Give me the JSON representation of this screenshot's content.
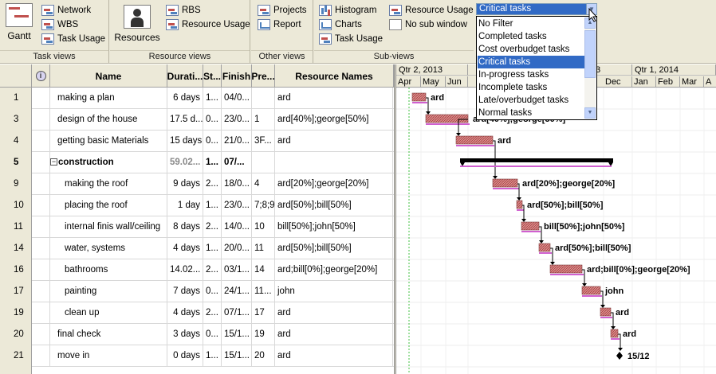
{
  "ribbon": {
    "task_views": {
      "label": "Task views",
      "gantt": "Gantt",
      "network": "Network",
      "wbs": "WBS",
      "task_usage": "Task Usage"
    },
    "resource_views": {
      "label": "Resource views",
      "resources": "Resources",
      "rbs": "RBS",
      "resource_usage": "Resource Usage"
    },
    "other_views": {
      "label": "Other views",
      "projects": "Projects",
      "report": "Report"
    },
    "sub_views": {
      "label": "Sub-views",
      "histogram": "Histogram",
      "charts": "Charts",
      "task_usage": "Task Usage",
      "resource_usage": "Resource Usage",
      "no_sub_window": "No sub window"
    }
  },
  "filter": {
    "selected": "Critical tasks",
    "options": [
      "No Filter",
      "Completed tasks",
      "Cost overbudget tasks",
      "Critical tasks",
      "In-progress tasks",
      "Incomplete tasks",
      "Late/overbudget tasks",
      "Normal tasks"
    ],
    "selected_index": 3
  },
  "table": {
    "columns": {
      "name": "Name",
      "duration": "Durati...",
      "start": "St...",
      "finish": "Finish",
      "pred": "Pre...",
      "resources": "Resource Names"
    },
    "rows": [
      {
        "id": "1",
        "name": "making a plan",
        "duration": "6 days",
        "start": "1...",
        "finish": "04/0...",
        "pred": "",
        "resources": "ard",
        "indent": 0,
        "summary": false
      },
      {
        "id": "3",
        "name": "design of the house",
        "duration": "17.5 d...",
        "start": "0...",
        "finish": "23/0...",
        "pred": "1",
        "resources": "ard[40%];george[50%]",
        "indent": 0,
        "summary": false
      },
      {
        "id": "4",
        "name": "getting basic Materials",
        "duration": "15 days",
        "start": "0...",
        "finish": "21/0...",
        "pred": "3F...",
        "resources": "ard",
        "indent": 0,
        "summary": false
      },
      {
        "id": "5",
        "name": "construction",
        "duration": "59.02...",
        "start": "1...",
        "finish": "07/...",
        "pred": "",
        "resources": "",
        "indent": 0,
        "summary": true
      },
      {
        "id": "9",
        "name": "making the  roof",
        "duration": "9 days",
        "start": "2...",
        "finish": "18/0...",
        "pred": "4",
        "resources": "ard[20%];george[20%]",
        "indent": 1,
        "summary": false
      },
      {
        "id": "10",
        "name": "placing the roof",
        "duration": "1 day",
        "start": "1...",
        "finish": "23/0...",
        "pred": "7;8;9",
        "resources": "ard[50%];bill[50%]",
        "indent": 1,
        "summary": false
      },
      {
        "id": "11",
        "name": "internal finis wall/ceiling",
        "duration": "8 days",
        "start": "2...",
        "finish": "14/0...",
        "pred": "10",
        "resources": "bill[50%];john[50%]",
        "indent": 1,
        "summary": false
      },
      {
        "id": "14",
        "name": "water, systems",
        "duration": "4 days",
        "start": "1...",
        "finish": "20/0...",
        "pred": "11",
        "resources": "ard[50%];bill[50%]",
        "indent": 1,
        "summary": false
      },
      {
        "id": "16",
        "name": "bathrooms",
        "duration": "14.02...",
        "start": "2...",
        "finish": "03/1...",
        "pred": "14",
        "resources": "ard;bill[0%];george[20%]",
        "indent": 1,
        "summary": false
      },
      {
        "id": "17",
        "name": "painting",
        "duration": "7 days",
        "start": "0...",
        "finish": "24/1...",
        "pred": "11...",
        "resources": "john",
        "indent": 1,
        "summary": false
      },
      {
        "id": "19",
        "name": "clean up",
        "duration": "4 days",
        "start": "2...",
        "finish": "07/1...",
        "pred": "17",
        "resources": "ard",
        "indent": 1,
        "summary": false
      },
      {
        "id": "20",
        "name": "final check",
        "duration": "3 days",
        "start": "0...",
        "finish": "15/1...",
        "pred": "19",
        "resources": "ard",
        "indent": 0,
        "summary": false
      },
      {
        "id": "21",
        "name": "move in",
        "duration": "0 days",
        "start": "1...",
        "finish": "15/1...",
        "pred": "20",
        "resources": "ard",
        "indent": 0,
        "summary": false
      }
    ]
  },
  "gantt": {
    "quarters": [
      "Qtr 2, 2013",
      "3",
      "Qtr 1, 2014"
    ],
    "months": [
      "Apr",
      "May",
      "Jun",
      "Dec",
      "Jan",
      "Feb",
      "Mar",
      "A"
    ],
    "bar_labels": [
      "ard",
      "ard[40%];george[50%]",
      "ard",
      "",
      "ard[20%];george[20%]",
      "ard[50%];bill[50%]",
      "bill[50%];john[50%]",
      "ard[50%];bill[50%]",
      "ard;bill[0%];george[20%]",
      "john",
      "ard",
      "ard",
      "15/12"
    ],
    "colors": {
      "task_bar": "#dc8c8c",
      "critical_hatch": "#d060d0",
      "summary": "#000000",
      "today_line": "#40c040"
    }
  }
}
